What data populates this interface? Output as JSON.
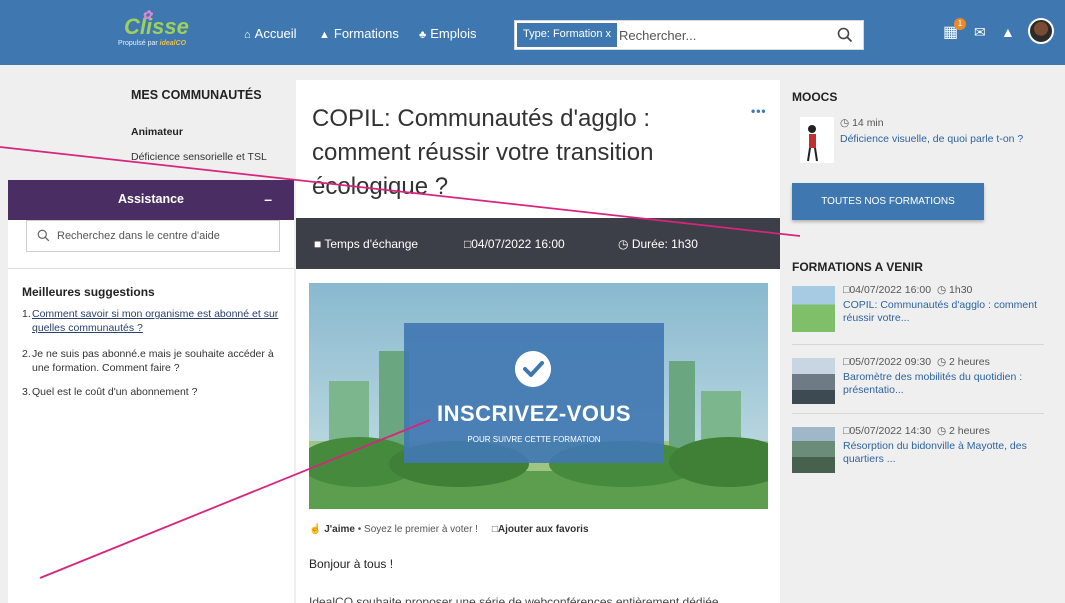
{
  "header": {
    "logo_text": "Clisse",
    "logo_sub": "Propulsé par",
    "logo_brand": "idealCO",
    "nav": [
      {
        "label": "Accueil",
        "icon": "home-icon"
      },
      {
        "label": "Formations",
        "icon": "graduation-cap-icon"
      },
      {
        "label": "Emplois",
        "icon": "trophy-icon"
      }
    ],
    "search_chip": "Type: Formation",
    "search_chip_close": "x",
    "search_placeholder": "Rechercher...",
    "notification_count": "1"
  },
  "left": {
    "communities_title": "MES COMMUNAUTÉS",
    "role": "Animateur",
    "community": "Déficience sensorielle et TSL"
  },
  "assistance": {
    "title": "Assistance",
    "minimize": "–",
    "search_placeholder": "Recherchez dans le centre d'aide",
    "suggestions_title": "Meilleures suggestions",
    "suggestions": [
      {
        "n": "1.",
        "text": "Comment savoir si mon organisme est abonné et sur quelles communautés ?"
      },
      {
        "n": "2.",
        "text": "Je ne suis pas abonné.e mais je souhaite accéder à une formation. Comment faire ?"
      },
      {
        "n": "3.",
        "text": "Quel est le coût d'un abonnement ?"
      }
    ]
  },
  "event": {
    "title": "COPIL: Communautés d'agglo : comment réussir votre transition écologique ?",
    "more": "•••",
    "type": "Temps d'échange",
    "date": "04/07/2022 16:00",
    "duration": "Durée: 1h30",
    "cta_main": "INSCRIVEZ-VOUS",
    "cta_sub": "POUR SUIVRE CETTE FORMATION",
    "like": "J'aime",
    "like_text": "• Soyez le premier à voter !",
    "favorite": "Ajouter aux favoris",
    "greeting": "Bonjour à tous !",
    "intro_cut": "IdealCO souhaite proposer une série de webconférences entièrement dédiée"
  },
  "right": {
    "moocs_title": "MOOCS",
    "mooc_time": "14 min",
    "mooc_title": "Déficience visuelle, de quoi parle t-on ?",
    "all_trainings": "TOUTES NOS FORMATIONS",
    "upcoming_title": "FORMATIONS A VENIR",
    "upcoming": [
      {
        "date": "04/07/2022 16:00",
        "duration": "1h30",
        "title": "COPIL: Communautés d'agglo : comment réussir votre..."
      },
      {
        "date": "05/07/2022 09:30",
        "duration": "2 heures",
        "title": "Baromètre des mobilités du quotidien : présentatio..."
      },
      {
        "date": "05/07/2022 14:30",
        "duration": "2 heures",
        "title": "Résorption du bidonville à Mayotte, des quartiers ..."
      }
    ]
  },
  "colors": {
    "brand": "#3f78b0",
    "assistance": "#4a2e63",
    "info_bar": "#3c3f47",
    "link": "#2e63a0",
    "annotation": "#d8247c"
  }
}
